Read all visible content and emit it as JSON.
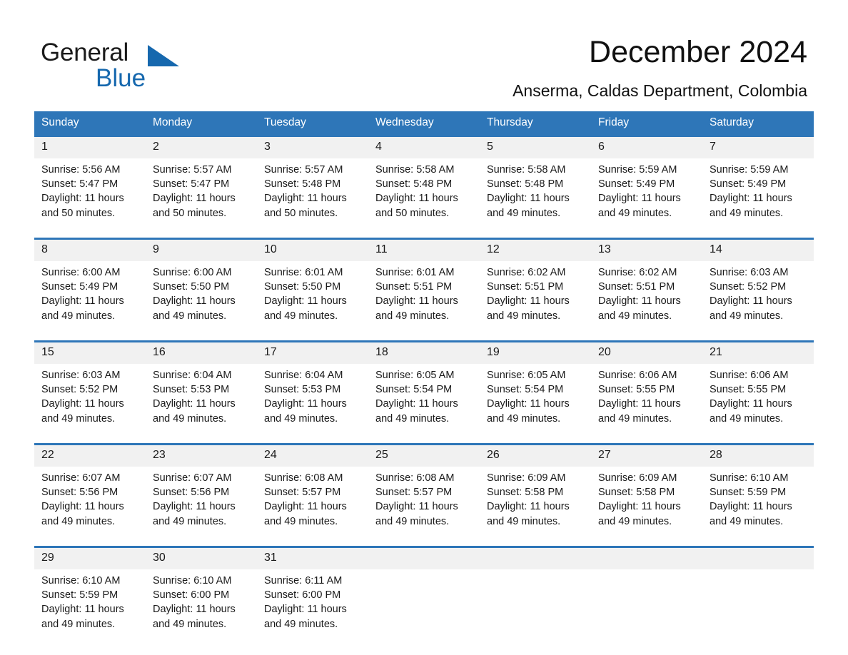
{
  "brand": {
    "name_part1": "General",
    "name_part2": "Blue",
    "triangle_icon": "triangle-icon",
    "accent_color": "#1668ae"
  },
  "header": {
    "title": "December 2024",
    "subtitle": "Anserma, Caldas Department, Colombia"
  },
  "calendar": {
    "header_bg_color": "#2e76b8",
    "daynum_bg_color": "#f1f1f1",
    "weekday_headers": [
      "Sunday",
      "Monday",
      "Tuesday",
      "Wednesday",
      "Thursday",
      "Friday",
      "Saturday"
    ],
    "weeks": [
      [
        {
          "day": "1",
          "sunrise": "Sunrise: 5:56 AM",
          "sunset": "Sunset: 5:47 PM",
          "daylight_line1": "Daylight: 11 hours",
          "daylight_line2": "and 50 minutes."
        },
        {
          "day": "2",
          "sunrise": "Sunrise: 5:57 AM",
          "sunset": "Sunset: 5:47 PM",
          "daylight_line1": "Daylight: 11 hours",
          "daylight_line2": "and 50 minutes."
        },
        {
          "day": "3",
          "sunrise": "Sunrise: 5:57 AM",
          "sunset": "Sunset: 5:48 PM",
          "daylight_line1": "Daylight: 11 hours",
          "daylight_line2": "and 50 minutes."
        },
        {
          "day": "4",
          "sunrise": "Sunrise: 5:58 AM",
          "sunset": "Sunset: 5:48 PM",
          "daylight_line1": "Daylight: 11 hours",
          "daylight_line2": "and 50 minutes."
        },
        {
          "day": "5",
          "sunrise": "Sunrise: 5:58 AM",
          "sunset": "Sunset: 5:48 PM",
          "daylight_line1": "Daylight: 11 hours",
          "daylight_line2": "and 49 minutes."
        },
        {
          "day": "6",
          "sunrise": "Sunrise: 5:59 AM",
          "sunset": "Sunset: 5:49 PM",
          "daylight_line1": "Daylight: 11 hours",
          "daylight_line2": "and 49 minutes."
        },
        {
          "day": "7",
          "sunrise": "Sunrise: 5:59 AM",
          "sunset": "Sunset: 5:49 PM",
          "daylight_line1": "Daylight: 11 hours",
          "daylight_line2": "and 49 minutes."
        }
      ],
      [
        {
          "day": "8",
          "sunrise": "Sunrise: 6:00 AM",
          "sunset": "Sunset: 5:49 PM",
          "daylight_line1": "Daylight: 11 hours",
          "daylight_line2": "and 49 minutes."
        },
        {
          "day": "9",
          "sunrise": "Sunrise: 6:00 AM",
          "sunset": "Sunset: 5:50 PM",
          "daylight_line1": "Daylight: 11 hours",
          "daylight_line2": "and 49 minutes."
        },
        {
          "day": "10",
          "sunrise": "Sunrise: 6:01 AM",
          "sunset": "Sunset: 5:50 PM",
          "daylight_line1": "Daylight: 11 hours",
          "daylight_line2": "and 49 minutes."
        },
        {
          "day": "11",
          "sunrise": "Sunrise: 6:01 AM",
          "sunset": "Sunset: 5:51 PM",
          "daylight_line1": "Daylight: 11 hours",
          "daylight_line2": "and 49 minutes."
        },
        {
          "day": "12",
          "sunrise": "Sunrise: 6:02 AM",
          "sunset": "Sunset: 5:51 PM",
          "daylight_line1": "Daylight: 11 hours",
          "daylight_line2": "and 49 minutes."
        },
        {
          "day": "13",
          "sunrise": "Sunrise: 6:02 AM",
          "sunset": "Sunset: 5:51 PM",
          "daylight_line1": "Daylight: 11 hours",
          "daylight_line2": "and 49 minutes."
        },
        {
          "day": "14",
          "sunrise": "Sunrise: 6:03 AM",
          "sunset": "Sunset: 5:52 PM",
          "daylight_line1": "Daylight: 11 hours",
          "daylight_line2": "and 49 minutes."
        }
      ],
      [
        {
          "day": "15",
          "sunrise": "Sunrise: 6:03 AM",
          "sunset": "Sunset: 5:52 PM",
          "daylight_line1": "Daylight: 11 hours",
          "daylight_line2": "and 49 minutes."
        },
        {
          "day": "16",
          "sunrise": "Sunrise: 6:04 AM",
          "sunset": "Sunset: 5:53 PM",
          "daylight_line1": "Daylight: 11 hours",
          "daylight_line2": "and 49 minutes."
        },
        {
          "day": "17",
          "sunrise": "Sunrise: 6:04 AM",
          "sunset": "Sunset: 5:53 PM",
          "daylight_line1": "Daylight: 11 hours",
          "daylight_line2": "and 49 minutes."
        },
        {
          "day": "18",
          "sunrise": "Sunrise: 6:05 AM",
          "sunset": "Sunset: 5:54 PM",
          "daylight_line1": "Daylight: 11 hours",
          "daylight_line2": "and 49 minutes."
        },
        {
          "day": "19",
          "sunrise": "Sunrise: 6:05 AM",
          "sunset": "Sunset: 5:54 PM",
          "daylight_line1": "Daylight: 11 hours",
          "daylight_line2": "and 49 minutes."
        },
        {
          "day": "20",
          "sunrise": "Sunrise: 6:06 AM",
          "sunset": "Sunset: 5:55 PM",
          "daylight_line1": "Daylight: 11 hours",
          "daylight_line2": "and 49 minutes."
        },
        {
          "day": "21",
          "sunrise": "Sunrise: 6:06 AM",
          "sunset": "Sunset: 5:55 PM",
          "daylight_line1": "Daylight: 11 hours",
          "daylight_line2": "and 49 minutes."
        }
      ],
      [
        {
          "day": "22",
          "sunrise": "Sunrise: 6:07 AM",
          "sunset": "Sunset: 5:56 PM",
          "daylight_line1": "Daylight: 11 hours",
          "daylight_line2": "and 49 minutes."
        },
        {
          "day": "23",
          "sunrise": "Sunrise: 6:07 AM",
          "sunset": "Sunset: 5:56 PM",
          "daylight_line1": "Daylight: 11 hours",
          "daylight_line2": "and 49 minutes."
        },
        {
          "day": "24",
          "sunrise": "Sunrise: 6:08 AM",
          "sunset": "Sunset: 5:57 PM",
          "daylight_line1": "Daylight: 11 hours",
          "daylight_line2": "and 49 minutes."
        },
        {
          "day": "25",
          "sunrise": "Sunrise: 6:08 AM",
          "sunset": "Sunset: 5:57 PM",
          "daylight_line1": "Daylight: 11 hours",
          "daylight_line2": "and 49 minutes."
        },
        {
          "day": "26",
          "sunrise": "Sunrise: 6:09 AM",
          "sunset": "Sunset: 5:58 PM",
          "daylight_line1": "Daylight: 11 hours",
          "daylight_line2": "and 49 minutes."
        },
        {
          "day": "27",
          "sunrise": "Sunrise: 6:09 AM",
          "sunset": "Sunset: 5:58 PM",
          "daylight_line1": "Daylight: 11 hours",
          "daylight_line2": "and 49 minutes."
        },
        {
          "day": "28",
          "sunrise": "Sunrise: 6:10 AM",
          "sunset": "Sunset: 5:59 PM",
          "daylight_line1": "Daylight: 11 hours",
          "daylight_line2": "and 49 minutes."
        }
      ],
      [
        {
          "day": "29",
          "sunrise": "Sunrise: 6:10 AM",
          "sunset": "Sunset: 5:59 PM",
          "daylight_line1": "Daylight: 11 hours",
          "daylight_line2": "and 49 minutes."
        },
        {
          "day": "30",
          "sunrise": "Sunrise: 6:10 AM",
          "sunset": "Sunset: 6:00 PM",
          "daylight_line1": "Daylight: 11 hours",
          "daylight_line2": "and 49 minutes."
        },
        {
          "day": "31",
          "sunrise": "Sunrise: 6:11 AM",
          "sunset": "Sunset: 6:00 PM",
          "daylight_line1": "Daylight: 11 hours",
          "daylight_line2": "and 49 minutes."
        },
        {
          "day": "",
          "sunrise": "",
          "sunset": "",
          "daylight_line1": "",
          "daylight_line2": ""
        },
        {
          "day": "",
          "sunrise": "",
          "sunset": "",
          "daylight_line1": "",
          "daylight_line2": ""
        },
        {
          "day": "",
          "sunrise": "",
          "sunset": "",
          "daylight_line1": "",
          "daylight_line2": ""
        },
        {
          "day": "",
          "sunrise": "",
          "sunset": "",
          "daylight_line1": "",
          "daylight_line2": ""
        }
      ]
    ]
  }
}
